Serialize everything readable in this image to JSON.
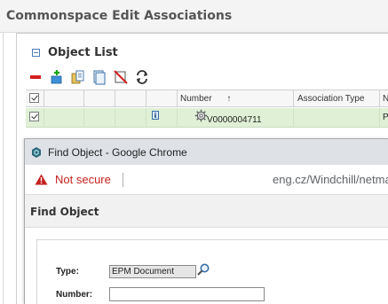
{
  "dialog": {
    "title": "Commonspace Edit Associations"
  },
  "object_list": {
    "title": "Object List",
    "toolbar_icons": [
      "remove-icon",
      "add-icon",
      "paste-icon",
      "copy-icon",
      "clear-icon",
      "refresh-icon"
    ],
    "columns": [
      "",
      "",
      "",
      "",
      "",
      "Number",
      "Association Type",
      "Name"
    ],
    "sort_indicator": "↑",
    "rows": [
      {
        "number": "V0000004711",
        "association_type": "",
        "name": "PH"
      }
    ]
  },
  "browser": {
    "window_title": "Find Object - Google Chrome",
    "security_label": "Not secure",
    "url_visible": "eng.cz/Windchill/netmarkets"
  },
  "find_object": {
    "title": "Find Object",
    "type_label": "Type:",
    "type_value": "EPM Document",
    "number_label": "Number:",
    "number_value": ""
  }
}
